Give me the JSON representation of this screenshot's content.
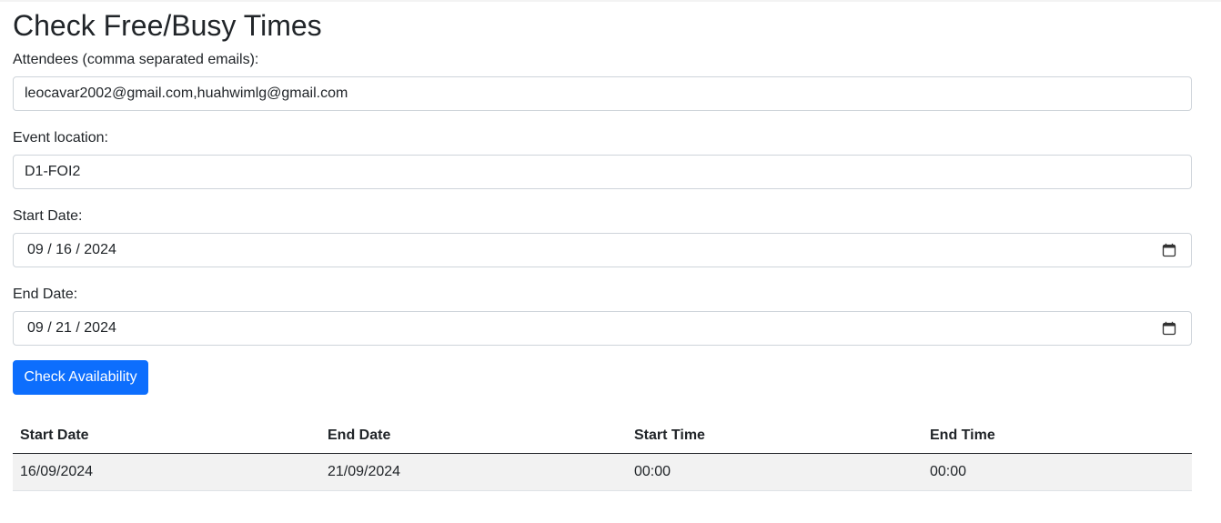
{
  "page": {
    "title": "Check Free/Busy Times"
  },
  "form": {
    "attendees": {
      "label": "Attendees (comma separated emails):",
      "value": "leocavar2002@gmail.com,huahwimlg@gmail.com"
    },
    "location": {
      "label": "Event location:",
      "value": "D1-FOI2"
    },
    "start_date": {
      "label": "Start Date:",
      "value": "09 / 16 / 2024",
      "icon": "calendar-icon"
    },
    "end_date": {
      "label": "End Date:",
      "value": "09 / 21 / 2024",
      "icon": "calendar-icon"
    },
    "submit_label": "Check Availability",
    "accent_color": "#0d6efd"
  },
  "results": {
    "headers": [
      "Start Date",
      "End Date",
      "Start Time",
      "End Time"
    ],
    "rows": [
      [
        "16/09/2024",
        "21/09/2024",
        "00:00",
        "00:00"
      ]
    ]
  }
}
